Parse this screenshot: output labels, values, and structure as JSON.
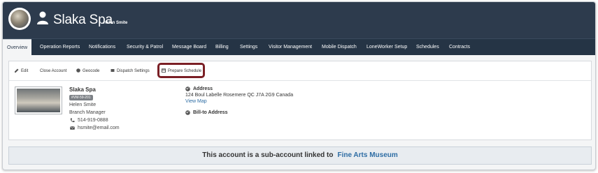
{
  "header": {
    "title": "Slaka Spa",
    "subtitle": "Helen Smite"
  },
  "nav": {
    "tabs": [
      {
        "label": "Overview",
        "active": true
      },
      {
        "label": "Operation Reports"
      },
      {
        "label": "Notifications"
      },
      {
        "label": "Security & Patrol"
      },
      {
        "label": "Message Board"
      },
      {
        "label": "Billing"
      },
      {
        "label": "Settings"
      },
      {
        "label": "Visitor Management"
      },
      {
        "label": "Mobile Dispatch"
      },
      {
        "label": "LoneWorker Setup"
      },
      {
        "label": "Schedules"
      },
      {
        "label": "Contracts"
      }
    ]
  },
  "toolbar": {
    "edit": "Edit",
    "close_account": "Close Account",
    "geocode": "Geocode",
    "dispatch_settings": "Dispatch Settings",
    "prepare_schedule": "Prepare Schedule"
  },
  "contact": {
    "name": "Slaka Spa",
    "badge": "#VM-59-201",
    "person": "Helen Smite",
    "role": "Branch Manager",
    "phone": "514-919-0888",
    "email": "hsmite@email.com"
  },
  "address": {
    "label": "Address",
    "line": "124 Boul Labelle Rosemere QC J7A 2G9 Canada",
    "link": "View Map",
    "bill_label": "Bill-to Address"
  },
  "banner": {
    "text": "This account is a sub-account linked to",
    "link": "Fine Arts Museum"
  },
  "colors": {
    "header_bg": "#2d3b4d",
    "nav_bg": "#253445",
    "link": "#2e6da4",
    "highlight": "#7a1f25"
  }
}
